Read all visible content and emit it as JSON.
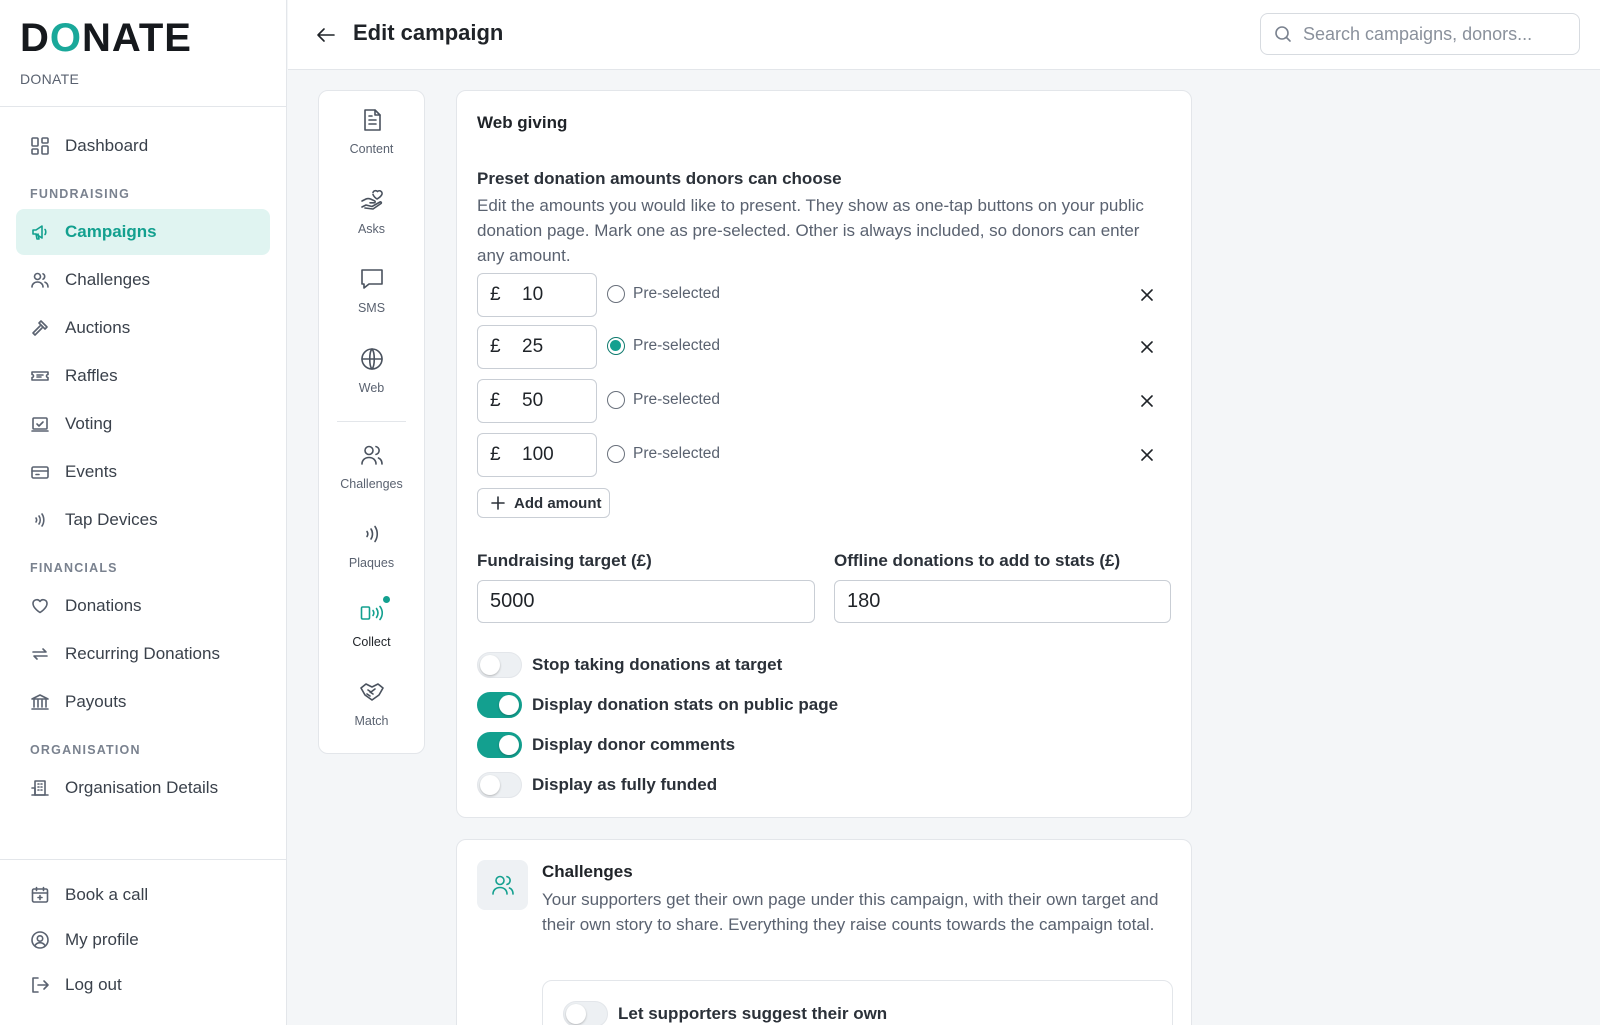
{
  "brand": {
    "logo": "DONATE",
    "subtitle": "DONATE",
    "accent_color": "#13a08f"
  },
  "sidebar": {
    "items": [
      {
        "label": "Dashboard",
        "icon": "dashboard-grid-icon"
      },
      {
        "label": "Campaigns",
        "icon": "megaphone-icon",
        "active": true
      },
      {
        "label": "Challenges",
        "icon": "users-icon"
      },
      {
        "label": "Auctions",
        "icon": "gavel-icon"
      },
      {
        "label": "Raffles",
        "icon": "ticket-icon"
      },
      {
        "label": "Voting",
        "icon": "ballot-icon"
      },
      {
        "label": "Events",
        "icon": "calendar-ticket-icon"
      },
      {
        "label": "Tap Devices",
        "icon": "contactless-icon"
      },
      {
        "label": "Donations",
        "icon": "heart-icon"
      },
      {
        "label": "Recurring Donations",
        "icon": "repeat-icon"
      },
      {
        "label": "Payouts",
        "icon": "bank-icon"
      },
      {
        "label": "Organisation Details",
        "icon": "building-icon"
      }
    ],
    "sections": [
      "FUNDRAISING",
      "FINANCIALS",
      "ORGANISATION"
    ],
    "bottom": [
      {
        "label": "Book a call",
        "icon": "calendar-plus-icon"
      },
      {
        "label": "My profile",
        "icon": "user-circle-icon"
      },
      {
        "label": "Log out",
        "icon": "logout-icon"
      }
    ]
  },
  "header": {
    "title": "Edit campaign",
    "search_placeholder": "Search campaigns, donors..."
  },
  "rail": {
    "items": [
      {
        "label": "Content",
        "icon": "document-icon"
      },
      {
        "label": "Asks",
        "icon": "hand-heart-icon"
      },
      {
        "label": "SMS",
        "icon": "chat-bubble-icon"
      },
      {
        "label": "Web",
        "icon": "globe-icon"
      },
      {
        "label": "Challenges",
        "icon": "users-icon"
      },
      {
        "label": "Plaques",
        "icon": "contactless-icon"
      },
      {
        "label": "Collect",
        "icon": "collect-device-icon",
        "active": true
      },
      {
        "label": "Match",
        "icon": "handshake-icon"
      }
    ]
  },
  "web_giving": {
    "title": "Web giving",
    "preset_heading": "Preset donation amounts donors can choose",
    "preset_description": "Edit the amounts you would like to present. They show as one-tap buttons on your public donation page. Mark one as pre-selected. Other is always included, so donors can enter any amount.",
    "currency_symbol": "£",
    "preselected_label": "Pre-selected",
    "amounts": [
      {
        "value": "10",
        "preselected": false
      },
      {
        "value": "25",
        "preselected": true
      },
      {
        "value": "50",
        "preselected": false
      },
      {
        "value": "100",
        "preselected": false
      }
    ],
    "add_amount_label": "Add amount",
    "target_label": "Fundraising target (£)",
    "target_value": "5000",
    "offline_label": "Offline donations to add to stats (£)",
    "offline_value": "180",
    "toggles": [
      {
        "label": "Stop taking donations at target",
        "on": false
      },
      {
        "label": "Display donation stats on public page",
        "on": true
      },
      {
        "label": "Display donor comments",
        "on": true
      },
      {
        "label": "Display as fully funded",
        "on": false
      }
    ]
  },
  "challenges": {
    "title": "Challenges",
    "description": "Your supporters get their own page under this campaign, with their own target and their own story to share. Everything they raise counts towards the campaign total.",
    "suggest_toggle": {
      "label": "Let supporters suggest their own",
      "on": false
    }
  }
}
